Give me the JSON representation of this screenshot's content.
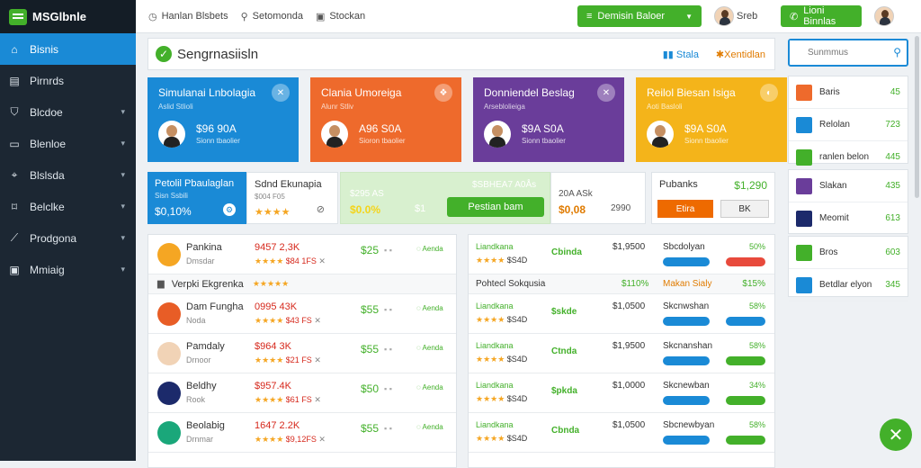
{
  "app": {
    "logo": "MSGlbnle"
  },
  "sidebar": {
    "items": [
      {
        "label": "Bisnis",
        "icon": "home-icon",
        "active": true
      },
      {
        "label": "Pirnrds",
        "icon": "calendar-icon"
      },
      {
        "label": "Blcdoe",
        "icon": "shield-icon",
        "chevron": true
      },
      {
        "label": "Blenloe",
        "icon": "monitor-icon",
        "chevron": true
      },
      {
        "label": "Blslsda",
        "icon": "location-icon",
        "chevron": true
      },
      {
        "label": "Belclke",
        "icon": "tag-icon",
        "chevron": true
      },
      {
        "label": "Prodgona",
        "icon": "chart-icon",
        "chevron": true
      },
      {
        "label": "Mmiaig",
        "icon": "box-icon",
        "chevron": true
      }
    ]
  },
  "topbar": {
    "links": [
      "Hanlan Blsbets",
      "Setomonda",
      "Stockan"
    ],
    "dropdown": "Demisin Baloer",
    "user_name": "Sreb",
    "action": "Lioni Binnlas"
  },
  "header": {
    "title": "Sengrnasiisln",
    "link1": "Stala",
    "link2": "Xentidlan"
  },
  "cards": [
    {
      "title": "Simulanai Lnbolagia",
      "sub": "Aslid Stlioli",
      "amount": "$96 90A",
      "amount_sub": "Sionn tbaolier",
      "color": "#1a8ad6",
      "badge": "✕"
    },
    {
      "title": "Clania Umoreiga",
      "sub": "Alunr Stliv",
      "amount": "A96 S0A",
      "amount_sub": "Sioron tbaolier",
      "color": "#ee6a2c",
      "badge": "❖"
    },
    {
      "title": "Donniendel Beslag",
      "sub": "Arseblolieiga",
      "amount": "$9A S0A",
      "amount_sub": "Sionn tbaolier",
      "color": "#6a3d9a",
      "badge": "✕"
    },
    {
      "title": "Reilol Biesan Isiga",
      "sub": "Aoti Basloli",
      "amount": "$9A S0A",
      "amount_sub": "Sionn tbaolier",
      "color": "#f4b41a",
      "badge": "◐"
    }
  ],
  "stats": {
    "s1": {
      "title": "Petolil Pbaulaglan",
      "sub": "Sisn Ssbili",
      "value": "$0,10%"
    },
    "s2": {
      "title": "Sdnd Ekunapia",
      "sub": "$004 F05",
      "rating": "★★★★"
    },
    "s3": {
      "v1": "$295 AS",
      "v2": "$0.0%",
      "v3": "$1",
      "total": "$SBHEA7 A0Ås",
      "btn": "Pestian bam"
    },
    "s4": {
      "v1": "20A ASk",
      "v2": "$0,08",
      "v3": "2990"
    },
    "s5": {
      "title": "Pubanks",
      "value": "$1,290",
      "btn1": "Etira",
      "btn2": "BK"
    }
  },
  "list": {
    "section": "Verpki Ekgrenka",
    "rows": [
      {
        "name": "Pankina",
        "sub": "Dmsdar",
        "v1": "9457 2,3K",
        "v2": "$84 1FS",
        "v3": "$25",
        "v4": "Aenda",
        "color": "#f5a623"
      },
      {
        "name": "Dam Fungha",
        "sub": "Noda",
        "v1": "0995 43K",
        "v2": "$43 FS",
        "v3": "$55",
        "v4": "Aenda",
        "color": "#e85d26"
      },
      {
        "name": "Pamdaly",
        "sub": "Drnoor",
        "v1": "$964 3K",
        "v2": "$21 FS",
        "v3": "$55",
        "v4": "Aenda",
        "color": "#f1d3b6"
      },
      {
        "name": "Beldhy",
        "sub": "Rook",
        "v1": "$957.4K",
        "v2": "$61 FS",
        "v3": "$50",
        "v4": "Aenda",
        "color": "#1c2a6b"
      },
      {
        "name": "Beolabig",
        "sub": "Drnmar",
        "v1": "1647 2.2K",
        "v2": "$9,12FS",
        "v3": "$55",
        "v4": "Aenda",
        "color": "#1aa77a"
      }
    ]
  },
  "list2": {
    "section": "Pohtecl Sokqusia",
    "section_v1": "$110%",
    "section_v2": "Makan Sialy",
    "section_v3": "$15%",
    "rows": [
      {
        "a": "Liandkana",
        "b": "$S4D",
        "c": "Cbinda",
        "d": "$1,9500",
        "e": "Sbcdolyan",
        "f": "50%",
        "pill": "#e84a3c"
      },
      {
        "a": "Liandkana",
        "b": "$S4D",
        "c": "$skde",
        "d": "$1,0500",
        "e": "Skcnwshan",
        "f": "58%",
        "pill": "#1a8ad6"
      },
      {
        "a": "Liandkana",
        "b": "$S4D",
        "c": "Ctnda",
        "d": "$1,9500",
        "e": "Skcnanshan",
        "f": "58%",
        "pill": "#43b02a"
      },
      {
        "a": "Liandkana",
        "b": "$S4D",
        "c": "$pkda",
        "d": "$1,0000",
        "e": "Skcnewban",
        "f": "34%",
        "pill": "#43b02a"
      },
      {
        "a": "Liandkana",
        "b": "$S4D",
        "c": "Cbnda",
        "d": "$1,0500",
        "e": "Sbcnewbyan",
        "f": "58%",
        "pill": "#43b02a"
      }
    ]
  },
  "right": {
    "search_placeholder": "Sunmmus",
    "items": [
      {
        "label": "Baris",
        "value": "45",
        "color": "#ee6a2c"
      },
      {
        "label": "Relolan",
        "value": "723",
        "color": "#1a8ad6"
      },
      {
        "label": "ranlen belon",
        "value": "445",
        "color": "#43b02a"
      },
      {
        "label": "Slakan",
        "value": "435",
        "color": "#6a3d9a"
      },
      {
        "label": "Meomit",
        "value": "613",
        "color": "#1c2a6b"
      },
      {
        "label": "Bros",
        "value": "603",
        "color": "#43b02a"
      },
      {
        "label": "Betdlar elyon",
        "value": "345",
        "color": "#1a8ad6"
      }
    ]
  }
}
